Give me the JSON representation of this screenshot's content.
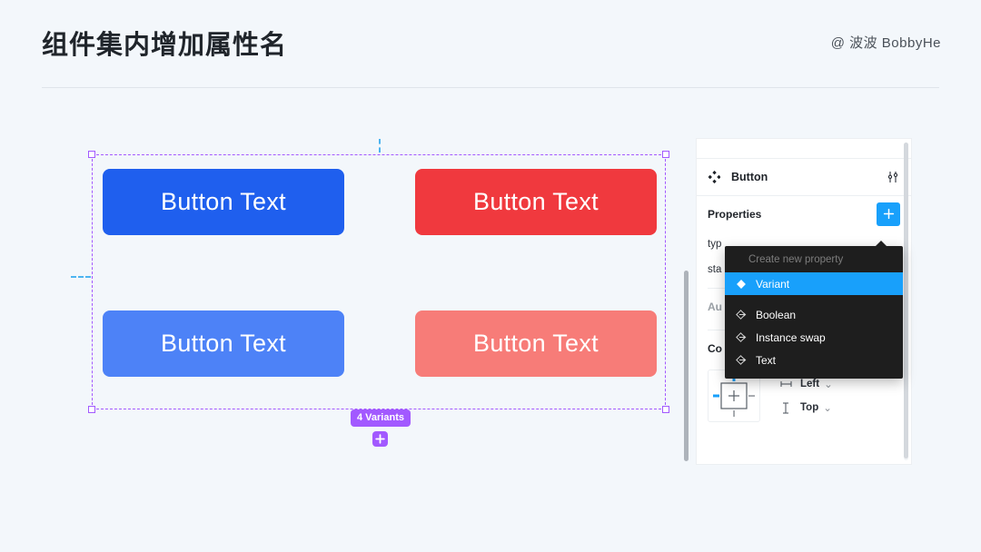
{
  "header": {
    "title": "组件集内增加属性名",
    "handle": "@ 波波 BobbyHe"
  },
  "canvas": {
    "buttons": [
      {
        "label": "Button Text",
        "color": "#1f5fee"
      },
      {
        "label": "Button Text",
        "color": "#f0393e"
      },
      {
        "label": "Button Text",
        "color": "#4d82f7"
      },
      {
        "label": "Button Text",
        "color": "#f77c78"
      }
    ],
    "variants_badge": "4 Variants",
    "selection_color": "#a259ff",
    "guide_color": "#4db4f0"
  },
  "panel": {
    "component_name": "Button",
    "component_icon": "component-icon",
    "tune_icon": "tune-icon",
    "properties": {
      "title": "Properties",
      "add_label": "+",
      "accent": "#18a0fb",
      "rows": [
        {
          "label": "typ"
        },
        {
          "label": "sta"
        }
      ]
    },
    "auto_layout": {
      "title": "Au"
    },
    "constraints": {
      "title": "Co",
      "horizontal": "Left",
      "vertical": "Top",
      "caret": "⌄"
    }
  },
  "menu": {
    "title": "Create new property",
    "items": [
      {
        "label": "Variant",
        "icon": "diamond-filled-icon",
        "selected": true
      },
      {
        "label": "Boolean",
        "icon": "diamond-arrow-icon",
        "selected": false
      },
      {
        "label": "Instance swap",
        "icon": "diamond-arrow-icon",
        "selected": false
      },
      {
        "label": "Text",
        "icon": "diamond-arrow-icon",
        "selected": false
      }
    ],
    "highlight": "#18a0fb",
    "background": "#1e1e1e"
  }
}
